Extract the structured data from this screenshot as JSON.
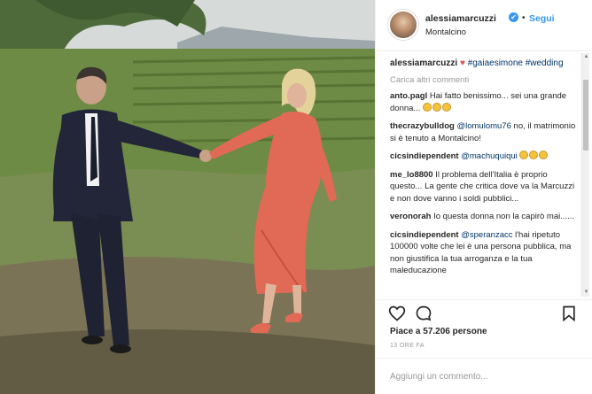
{
  "header": {
    "username": "alessiamarcuzzi",
    "verified": "✔",
    "separator": "•",
    "follow_label": "Segui",
    "location": "Montalcino"
  },
  "caption": {
    "username": "alessiamarcuzzi",
    "heart": "♥",
    "hashtags": "#gaiaesimone #wedding"
  },
  "load_more_label": "Carica altri commenti",
  "comments": [
    {
      "user": "anto.pagl",
      "text": "Hai fatto benissimo... sei una grande donna..."
    },
    {
      "user": "thecrazybulldog",
      "mention": "@lomulomu76",
      "text": " no, il matrimonio si è tenuto a Montalcino!"
    },
    {
      "user": "cicsindiependent",
      "mention": "@machuquiqui",
      "text": " "
    },
    {
      "user": "me_lo8800",
      "text": "Il problema dell'Italia è proprio questo... La gente che critica dove va la Marcuzzi e non dove vanno i soldi pubblici..."
    },
    {
      "user": "veronorah",
      "text": "Io questa donna non la capirò mai......"
    },
    {
      "user": "cicsindiependent",
      "mention": "@speranzacc",
      "text": " l'hai ripetuto 100000 volte che lei è una persona pubblica, ma non giustifica la tua arroganza e la tua maleducazione"
    }
  ],
  "likes_text": "Piace a 57.206 persone",
  "time_text": "13 ORE FA",
  "add_comment_placeholder": "Aggiungi un commento...",
  "icons": [
    "heart-icon",
    "comment-icon",
    "bookmark-icon",
    "verified-badge"
  ],
  "colors": {
    "link_blue": "#3897f0",
    "text": "#262626",
    "muted": "#999999",
    "dress": "#e06a55"
  }
}
